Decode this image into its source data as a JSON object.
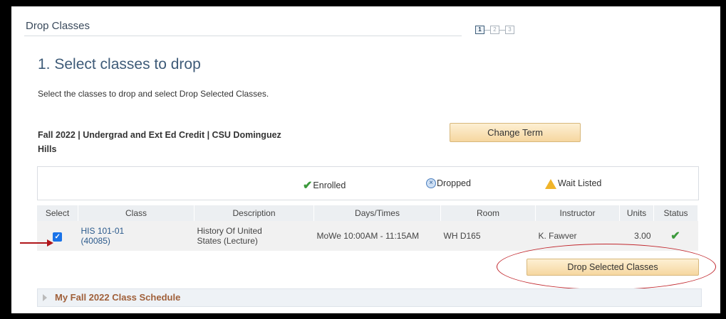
{
  "header": {
    "title": "Drop Classes",
    "steps": [
      "1",
      "2",
      "3"
    ]
  },
  "page": {
    "step_title": "1.  Select classes to drop",
    "instructions": "Select the classes to drop and select Drop Selected Classes.",
    "term_line1": "Fall 2022 | Undergrad and Ext Ed Credit | CSU Dominguez",
    "term_line2": "Hills",
    "change_term_label": "Change Term"
  },
  "legend": {
    "enrolled": "Enrolled",
    "dropped": "Dropped",
    "wait_listed": "Wait Listed"
  },
  "table": {
    "columns": [
      "Select",
      "Class",
      "Description",
      "Days/Times",
      "Room",
      "Instructor",
      "Units",
      "Status"
    ],
    "row": {
      "class_line1": "HIS 101-01",
      "class_line2": "(40085)",
      "description_line1": "History Of United",
      "description_line2": "States (Lecture)",
      "days_times": "MoWe 10:00AM - 11:15AM",
      "room": "WH D165",
      "instructor": "K. Fawver",
      "units": "3.00",
      "selected": true,
      "status": "enrolled"
    }
  },
  "actions": {
    "drop_label": "Drop Selected Classes"
  },
  "schedule": {
    "label": "My Fall 2022 Class Schedule"
  },
  "colors": {
    "accent_button": "#f6d7a0",
    "annotation_red": "#c1272d",
    "link": "#2b5a8c",
    "enrolled_green": "#3c9a3c"
  }
}
